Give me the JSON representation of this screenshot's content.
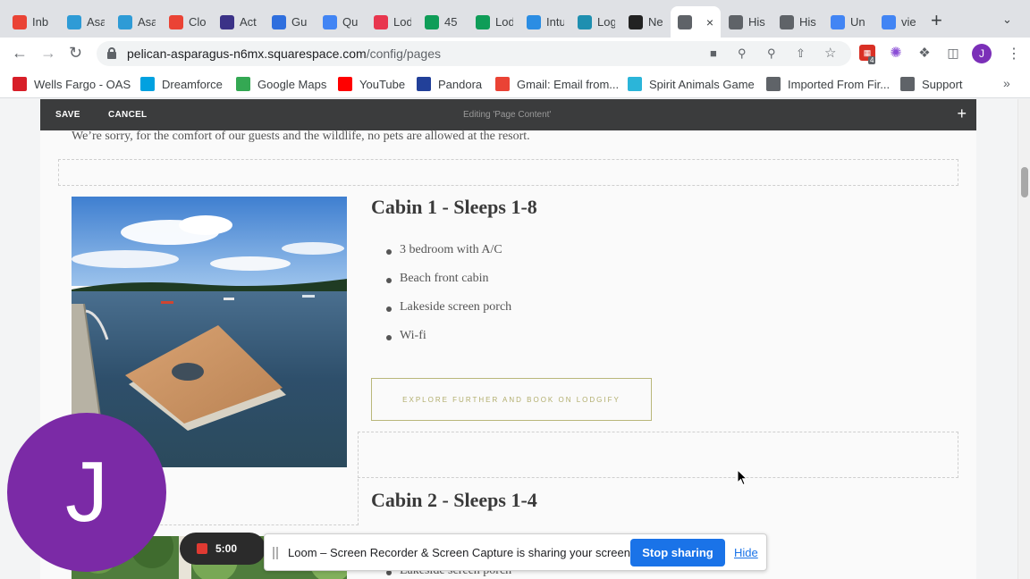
{
  "browser": {
    "tabs": [
      {
        "label": "Inb",
        "icon": "gmail-icon",
        "color": "#ea4335"
      },
      {
        "label": "Asa",
        "icon": "asana-icon",
        "color": "#2e9bd6"
      },
      {
        "label": "Asa",
        "icon": "asana-icon",
        "color": "#2e9bd6"
      },
      {
        "label": "Clo",
        "icon": "gmail-icon",
        "color": "#ea4335"
      },
      {
        "label": "Act",
        "icon": "act-icon",
        "color": "#3b3287"
      },
      {
        "label": "Gu",
        "icon": "guide-icon",
        "color": "#2f6fde"
      },
      {
        "label": "Qu",
        "icon": "docs-icon",
        "color": "#4285f4"
      },
      {
        "label": "Lod",
        "icon": "lodgify-icon",
        "color": "#e8364e"
      },
      {
        "label": "45",
        "icon": "sheets-icon",
        "color": "#0f9d58"
      },
      {
        "label": "Lod",
        "icon": "sheets-icon",
        "color": "#0f9d58"
      },
      {
        "label": "Intu",
        "icon": "intuit-icon",
        "color": "#2b8de3"
      },
      {
        "label": "Log",
        "icon": "login-icon",
        "color": "#1f8fb0"
      },
      {
        "label": "Ne",
        "icon": "squarespace-icon",
        "color": "#222222"
      },
      {
        "label": "",
        "icon": "lodge-icon",
        "color": "#5f6368",
        "active": true
      },
      {
        "label": "His",
        "icon": "lodge-icon",
        "color": "#5f6368"
      },
      {
        "label": "His",
        "icon": "lodge-icon",
        "color": "#5f6368"
      },
      {
        "label": "Un",
        "icon": "docs-icon",
        "color": "#4285f4"
      },
      {
        "label": "vie",
        "icon": "google-icon",
        "color": "#4285f4"
      }
    ],
    "url_domain": "pelican-asparagus-n6mx.squarespace.com",
    "url_path": "/config/pages",
    "profile_initial": "J",
    "extension_badge": "4",
    "bookmarks": [
      {
        "label": "Wells Fargo - OAS",
        "icon": "wells-fargo-icon",
        "color": "#d71e28"
      },
      {
        "label": "Dreamforce",
        "icon": "cloud-icon",
        "color": "#00a1e0"
      },
      {
        "label": "Google Maps",
        "icon": "maps-pin-icon",
        "color": "#34a853"
      },
      {
        "label": "YouTube",
        "icon": "youtube-icon",
        "color": "#ff0000"
      },
      {
        "label": "Pandora",
        "icon": "pandora-icon",
        "color": "#224099"
      },
      {
        "label": "Gmail: Email from...",
        "icon": "gmail-icon",
        "color": "#ea4335"
      },
      {
        "label": "Spirit Animals Game",
        "icon": "spirit-animals-icon",
        "color": "#2bb5d9"
      },
      {
        "label": "Imported From Fir...",
        "icon": "folder-icon",
        "color": "#5f6368"
      },
      {
        "label": "Support",
        "icon": "globe-icon",
        "color": "#5f6368"
      }
    ]
  },
  "editor": {
    "save_label": "SAVE",
    "cancel_label": "CANCEL",
    "editing_title": "Editing 'Page Content'"
  },
  "page": {
    "notice": "We’re sorry, for the comfort of our guests and the wildlife, no pets are allowed at the resort.",
    "cabin1": {
      "title": "Cabin 1  -  Sleeps 1-8",
      "amenities": [
        "3 bedroom with A/C",
        "Beach front cabin",
        "Lakeside screen porch",
        "Wi-fi"
      ],
      "cta": "EXPLORE FURTHER AND BOOK ON LODGIFY"
    },
    "cabin2": {
      "title": "Cabin 2  -  Sleeps 1-4",
      "partial_item": "Lakeside screen porch"
    }
  },
  "overlays": {
    "avatar_initial": "J",
    "recording_time": "5:00",
    "loom_message": "Loom – Screen Recorder & Screen Capture is sharing your screen.",
    "stop_sharing": "Stop sharing",
    "hide": "Hide"
  }
}
